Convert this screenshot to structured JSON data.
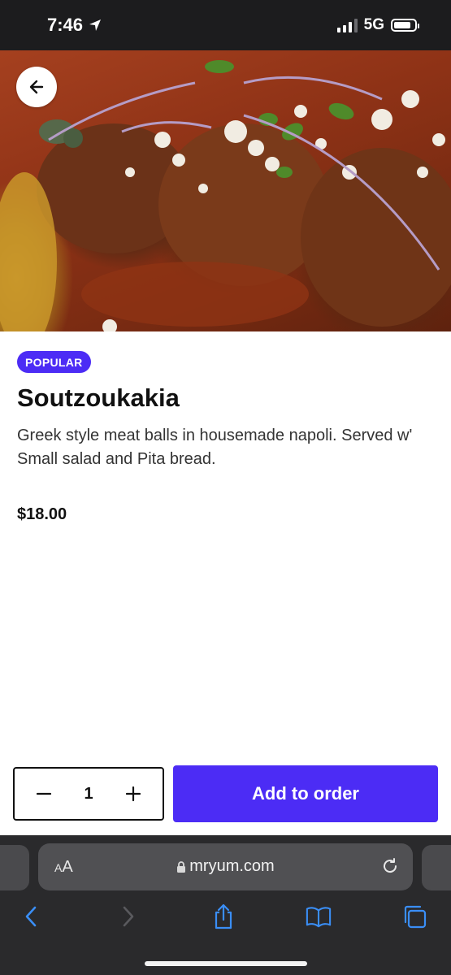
{
  "status_bar": {
    "time": "7:46",
    "network": "5G"
  },
  "item": {
    "badge": "POPULAR",
    "title": "Soutzoukakia",
    "description": "Greek style meat balls in housemade napoli. Served w' Small salad and Pita bread.",
    "price": "$18.00"
  },
  "order": {
    "quantity": "1",
    "add_label": "Add to order"
  },
  "browser": {
    "text_size_label_small": "A",
    "text_size_label_large": "A",
    "url": "mryum.com"
  },
  "colors": {
    "accent": "#4c2cf5",
    "safari_bg": "#2a2a2c",
    "safari_blue": "#3a8ef6"
  },
  "icons": {
    "back": "arrow-left-icon",
    "location": "location-arrow-icon",
    "minus": "minus-icon",
    "plus": "plus-icon",
    "lock": "lock-icon",
    "reload": "reload-icon",
    "nav_back": "chevron-left-icon",
    "nav_forward": "chevron-right-icon",
    "share": "share-icon",
    "bookmarks": "book-icon",
    "tabs": "tabs-icon"
  }
}
